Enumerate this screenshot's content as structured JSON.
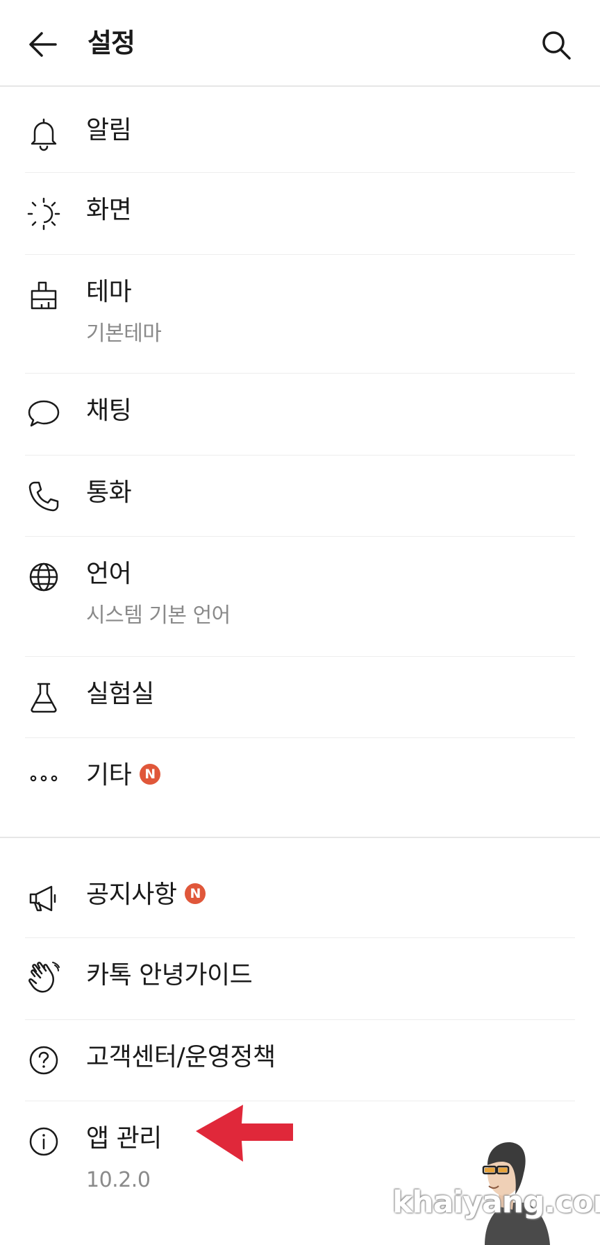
{
  "header": {
    "back_icon": "arrow-left-icon",
    "title": "설정",
    "search_icon": "search-icon"
  },
  "items": [
    {
      "icon": "bell-icon",
      "label": "알림"
    },
    {
      "icon": "brightness-icon",
      "label": "화면"
    },
    {
      "icon": "theme-brush-icon",
      "label": "테마",
      "sub": "기본테마"
    },
    {
      "icon": "chat-bubble-icon",
      "label": "채팅"
    },
    {
      "icon": "phone-icon",
      "label": "통화"
    },
    {
      "icon": "globe-icon",
      "label": "언어",
      "sub": "시스템 기본 언어"
    },
    {
      "icon": "flask-icon",
      "label": "실험실"
    },
    {
      "icon": "more-dots-icon",
      "label": "기타",
      "badge": "N"
    },
    {
      "icon": "megaphone-icon",
      "label": "공지사항",
      "badge": "N"
    },
    {
      "icon": "waving-hand-icon",
      "label": "카톡 안녕가이드"
    },
    {
      "icon": "help-circle-icon",
      "label": "고객센터/운영정책"
    },
    {
      "icon": "info-circle-icon",
      "label": "앱 관리",
      "sub": "10.2.0"
    }
  ],
  "annotation": {
    "arrow_color": "#e0283a"
  },
  "watermark": "khaiyang.com",
  "colors": {
    "badge": "#e0573a",
    "subtext": "#8a8a8a",
    "divider": "#ededed"
  }
}
